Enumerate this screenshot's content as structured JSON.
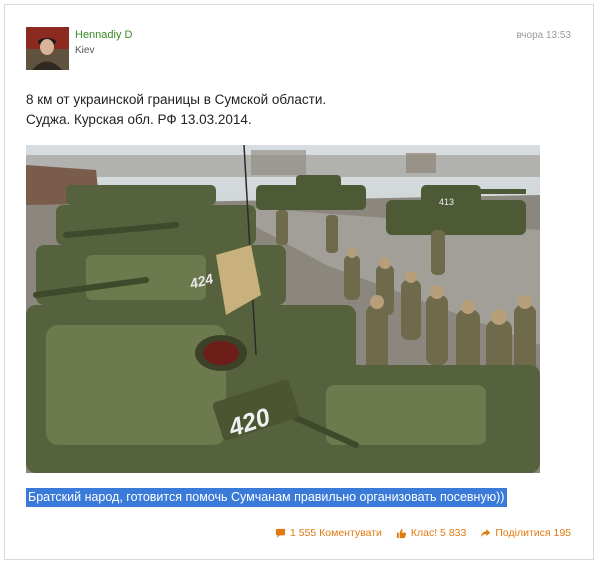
{
  "post": {
    "author": "Hennadiy D",
    "location": "Kiev",
    "timestamp": "вчора 13:53",
    "text_line1": "8 км от украинской границы в Сумской области.",
    "text_line2": "Суджа. Курская обл. РФ 13.03.2014.",
    "photo_tank_number": "420",
    "caption_selected": "Братский народ, готовится помочь Сумчанам правильно организовать посевную))"
  },
  "actions": {
    "comments_label": "1 555 Коментувати",
    "likes_label": "Клас! 5 833",
    "share_label": "Поділитися 195"
  },
  "icons": {
    "comment": "comment-bubble-icon",
    "like": "thumbs-up-icon",
    "share": "share-arrow-icon"
  },
  "colors": {
    "author": "#3a8a26",
    "selection": "#3a7ad9",
    "actions": "#e07a10"
  }
}
